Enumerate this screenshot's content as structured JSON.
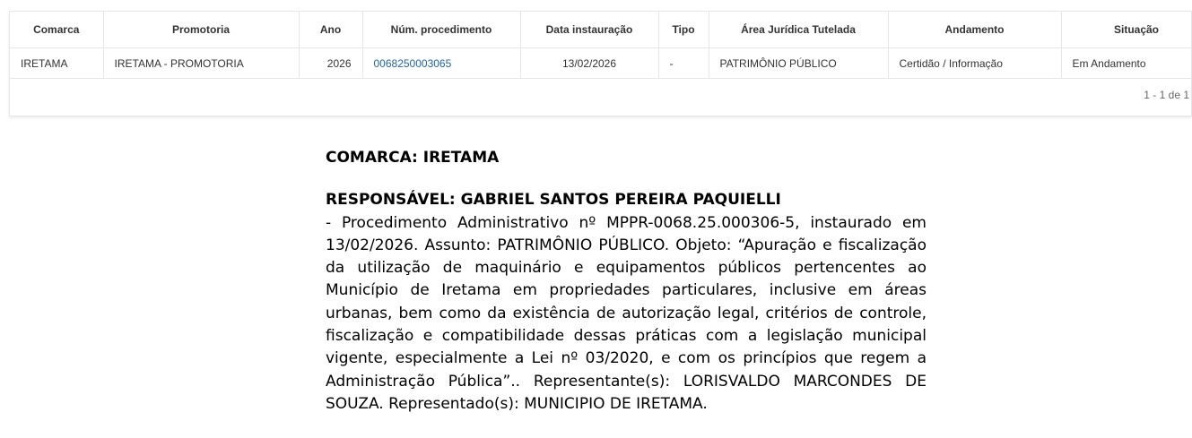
{
  "table": {
    "columns": [
      "Comarca",
      "Promotoria",
      "Ano",
      "Núm. procedimento",
      "Data instauração",
      "Tipo",
      "Área Jurídica Tutelada",
      "Andamento",
      "Situação"
    ],
    "rows": [
      {
        "comarca": "IRETAMA",
        "promotoria": "IRETAMA - PROMOTORIA",
        "ano": "2026",
        "num_procedimento": "0068250003065",
        "data_instauracao": "13/02/2026",
        "tipo": "-",
        "area_juridica": "PATRIMÔNIO PÚBLICO",
        "andamento": "Certidão / Informação",
        "situacao": "Em Andamento"
      }
    ],
    "pagination": "1 - 1 de 1"
  },
  "document": {
    "comarca": "COMARCA: IRETAMA",
    "responsavel": "RESPONSÁVEL: GABRIEL SANTOS PEREIRA PAQUIELLI",
    "body": "- Procedimento Administrativo nº MPPR-0068.25.000306-5, instaurado em 13/02/2026. Assunto: PATRIMÔNIO PÚBLICO. Objeto: “Apuração e fiscalização da utilização de maquinário e equipamentos públicos pertencentes ao Município de Iretama em propriedades particulares, inclusive em áreas urbanas, bem como da existência de autorização legal, critérios de controle, fiscalização e compatibilidade dessas práticas com a legislação municipal vigente, especialmente a Lei nº 03/2020, e com os princípios que regem a Administração Pública”.. Representante(s): LORISVALDO MARCONDES DE SOUZA. Representado(s): MUNICIPIO DE IRETAMA."
  },
  "colors": {
    "link": "#1f63a8",
    "border": "#e3e6ea"
  }
}
